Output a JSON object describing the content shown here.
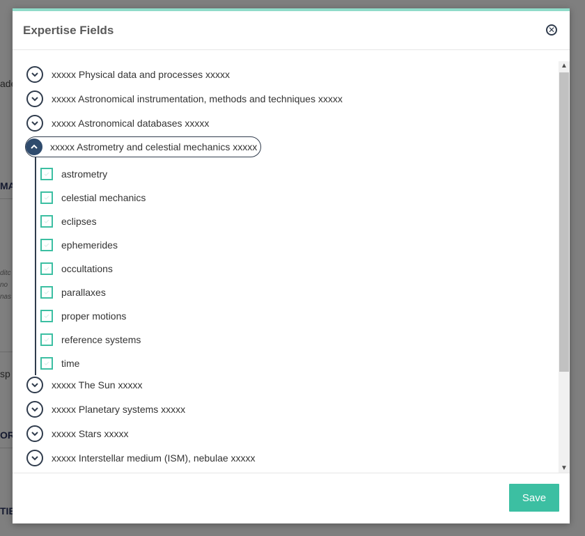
{
  "modal": {
    "title": "Expertise Fields",
    "close_icon": "close-circle-icon",
    "save_label": "Save"
  },
  "background": {
    "fragments": [
      "ade",
      "MA",
      "ditc",
      "no",
      "nas",
      "sp",
      "ORI",
      "TIES"
    ]
  },
  "tree": [
    {
      "label": "xxxxx Physical data and processes xxxxx",
      "expanded": false
    },
    {
      "label": "xxxxx Astronomical instrumentation, methods and techniques xxxxx",
      "expanded": false
    },
    {
      "label": "xxxxx Astronomical databases xxxxx",
      "expanded": false
    },
    {
      "label": "xxxxx Astrometry and celestial mechanics xxxxx",
      "expanded": true,
      "children": [
        {
          "label": "astrometry",
          "checked": false
        },
        {
          "label": "celestial mechanics",
          "checked": false
        },
        {
          "label": "eclipses",
          "checked": false
        },
        {
          "label": "ephemerides",
          "checked": false
        },
        {
          "label": "occultations",
          "checked": false
        },
        {
          "label": "parallaxes",
          "checked": false
        },
        {
          "label": "proper motions",
          "checked": false
        },
        {
          "label": "reference systems",
          "checked": false
        },
        {
          "label": "time",
          "checked": false
        }
      ]
    },
    {
      "label": "xxxxx The Sun xxxxx",
      "expanded": false
    },
    {
      "label": "xxxxx Planetary systems xxxxx",
      "expanded": false
    },
    {
      "label": "xxxxx Stars xxxxx",
      "expanded": false
    },
    {
      "label": "xxxxx Interstellar medium (ISM), nebulae xxxxx",
      "expanded": false
    }
  ],
  "colors": {
    "accent": "#3cbfa2",
    "top_border": "#8fdbc9",
    "dark": "#2f3b4c"
  }
}
